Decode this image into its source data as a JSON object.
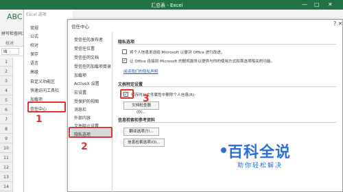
{
  "window": {
    "title": "汇总表 - Excel",
    "minimize": "—",
    "maximize": "□",
    "close": "✕"
  },
  "ribbon": {
    "spelling": "拼写检查",
    "thesaurus": "同义",
    "proofing": "校对"
  },
  "formula_bar": {
    "namebox": "I8"
  },
  "row_numbers": [
    "1",
    "2",
    "3",
    "4",
    "5",
    "6",
    "7",
    "8",
    "9",
    "10",
    "11",
    "12",
    "13",
    "14"
  ],
  "options_dialog": {
    "title": "Excel 选项",
    "items": [
      "常规",
      "公式",
      "校对",
      "保存",
      "语言",
      "高级",
      "自定义功能区",
      "快速访问工具栏",
      "加载项",
      "信任中心"
    ]
  },
  "trust_center": {
    "title": "信任中心",
    "close": "?  ✕",
    "nav": [
      "受信任的发布者",
      "受信任位置",
      "受信任的文档",
      "受信任的加载项目录",
      "加载项",
      "ActiveX 设置",
      "宏设置",
      "受保护的视图",
      "消息栏",
      "外部内容",
      "文件阻止设置",
      "隐私选项"
    ],
    "privacy": {
      "heading": "隐私选项",
      "option1": "将个人信息发送给 Microsoft 以便对 Office 进行改进。",
      "option2": "让 Office 连接到 Microsoft 的联机服务以提供与你的使用方式和首选项相关的功能。",
      "link": "阅读我们的隐私声明"
    },
    "doc_settings": {
      "heading": "文档特定设置",
      "option": "保存时从文件属性中删除个人信息(R)",
      "button": "文档检查器(D)..."
    },
    "research": {
      "heading": "信息检索和参考资料",
      "translate_button": "翻译选项(T)...",
      "research_button": "信息检索选项(O)..."
    }
  },
  "annotations": {
    "n1": "1",
    "n2": "2",
    "n3": "3"
  },
  "watermark": {
    "title": "百科全说",
    "sub": "助你轻松解决"
  }
}
